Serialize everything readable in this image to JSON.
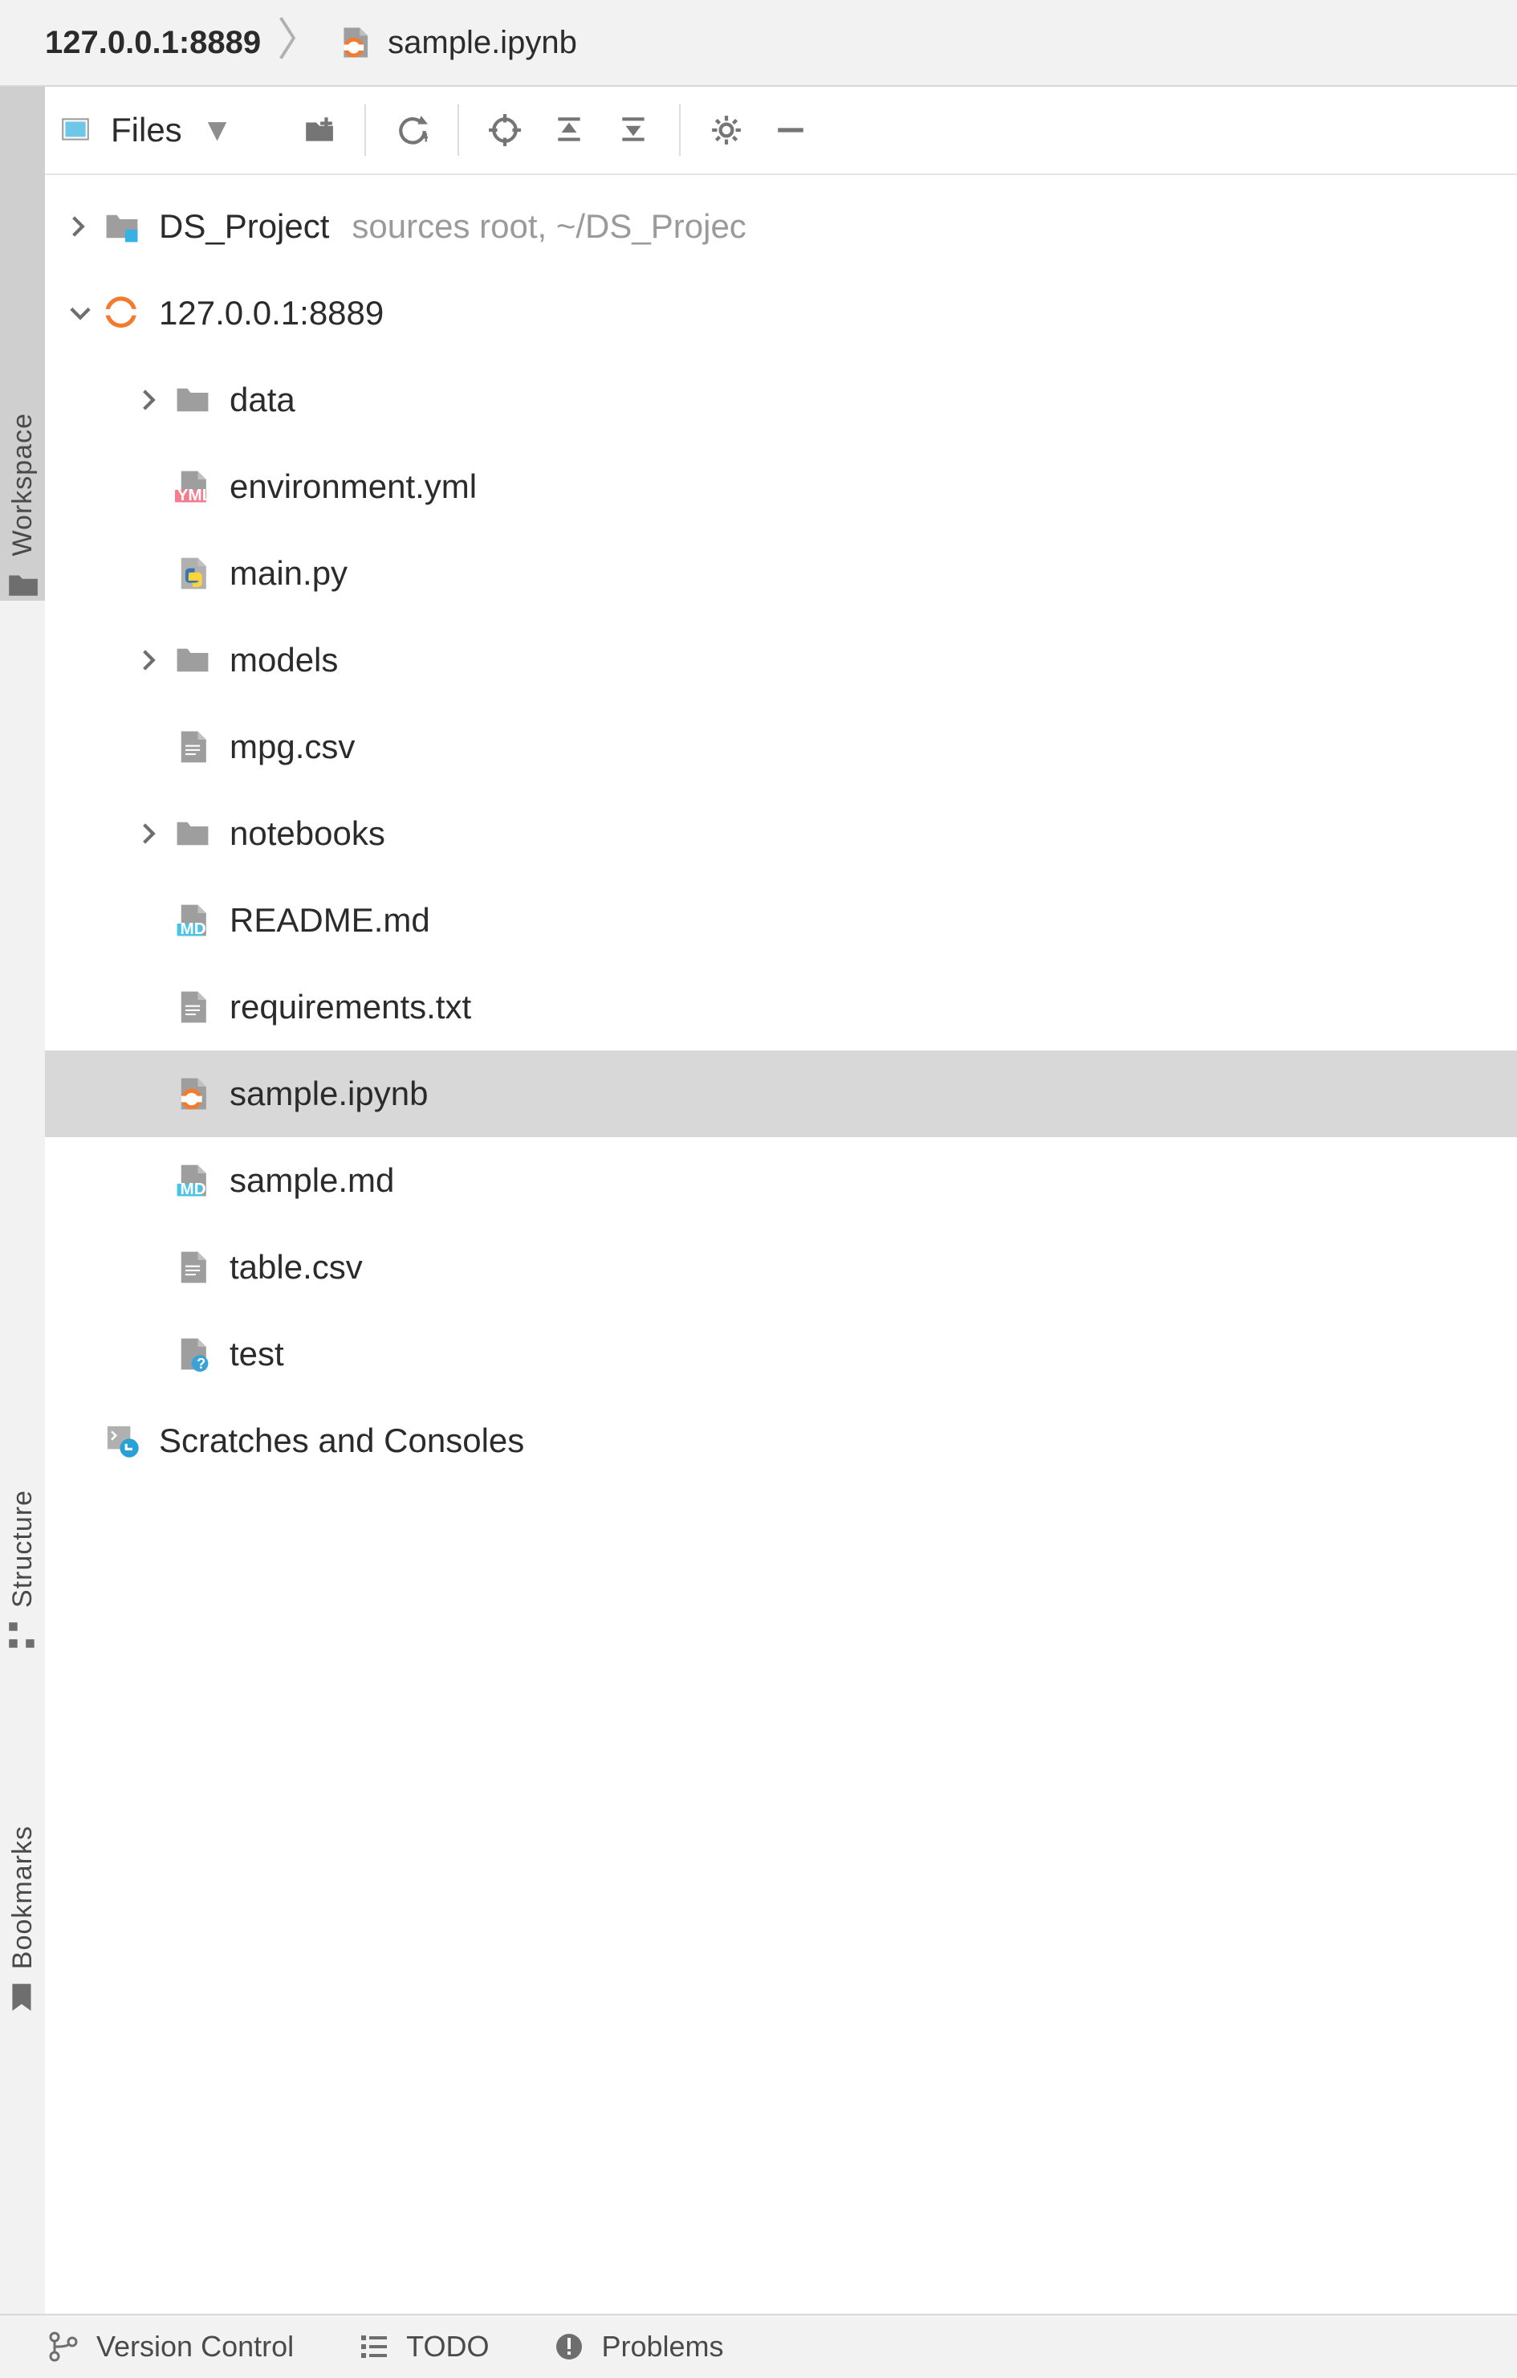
{
  "breadcrumb": {
    "host": "127.0.0.1:8889",
    "file": "sample.ipynb"
  },
  "sideTabs": {
    "workspace": "Workspace",
    "structure": "Structure",
    "bookmarks": "Bookmarks"
  },
  "toolbar": {
    "filesLabel": "Files"
  },
  "tree": {
    "nodes": [
      {
        "id": "ds_project",
        "depth": 0,
        "icon": "folder-src",
        "expand": "right",
        "name": "DS_Project",
        "extra": "sources root,  ~/DS_Projec"
      },
      {
        "id": "server",
        "depth": 0,
        "icon": "jupyter",
        "expand": "down",
        "name": "127.0.0.1:8889"
      },
      {
        "id": "data",
        "depth": 1,
        "icon": "folder",
        "expand": "right",
        "name": "data"
      },
      {
        "id": "environment",
        "depth": 1,
        "icon": "yml",
        "expand": "none",
        "name": "environment.yml"
      },
      {
        "id": "mainpy",
        "depth": 1,
        "icon": "py",
        "expand": "none",
        "name": "main.py"
      },
      {
        "id": "models",
        "depth": 1,
        "icon": "folder",
        "expand": "right",
        "name": "models"
      },
      {
        "id": "mpgcsv",
        "depth": 1,
        "icon": "txt",
        "expand": "none",
        "name": "mpg.csv"
      },
      {
        "id": "notebooks",
        "depth": 1,
        "icon": "folder",
        "expand": "right",
        "name": "notebooks"
      },
      {
        "id": "readme",
        "depth": 1,
        "icon": "md",
        "expand": "none",
        "name": "README.md"
      },
      {
        "id": "requirements",
        "depth": 1,
        "icon": "txt",
        "expand": "none",
        "name": "requirements.txt"
      },
      {
        "id": "sampleipynb",
        "depth": 1,
        "icon": "ipynb",
        "expand": "none",
        "name": "sample.ipynb",
        "selected": true
      },
      {
        "id": "samplemd",
        "depth": 1,
        "icon": "md",
        "expand": "none",
        "name": "sample.md"
      },
      {
        "id": "tablecsv",
        "depth": 1,
        "icon": "txt",
        "expand": "none",
        "name": "table.csv"
      },
      {
        "id": "test",
        "depth": 1,
        "icon": "unknown",
        "expand": "none",
        "name": "test"
      },
      {
        "id": "scratches",
        "depth": 0,
        "icon": "scratch",
        "expand": "none",
        "name": "Scratches and Consoles"
      }
    ]
  },
  "statusbar": {
    "vcs": "Version Control",
    "todo": "TODO",
    "problems": "Problems"
  }
}
